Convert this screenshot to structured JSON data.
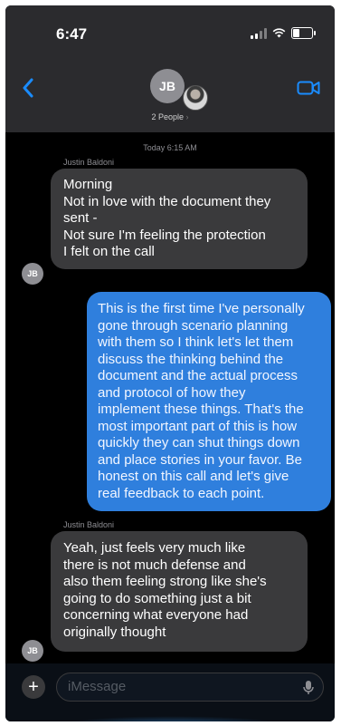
{
  "status_bar": {
    "time": "6:47"
  },
  "header": {
    "back_icon": "chevron-left-icon",
    "avatar_initials": "JB",
    "subtitle": "2 People",
    "video_icon": "video-camera-icon",
    "accent": "#1a8cff"
  },
  "conversation": {
    "timestamp": "Today 6:15 AM",
    "messages": [
      {
        "sender": "Justin Baldoni",
        "avatar": "JB",
        "direction": "received",
        "lines": [
          "Morning",
          "Not in love with the document they",
          "sent -",
          "Not sure I'm feeling the protection",
          "I felt on the call"
        ]
      },
      {
        "direction": "sent",
        "lines": [
          "This is the first time I've personally",
          "gone through scenario planning",
          "with them so I think let's let them",
          "discuss the thinking behind the",
          "document and the actual process",
          "and protocol of how they",
          "implement these things. That's the",
          "most important part of this is how",
          "quickly they can shut things down",
          "and place stories in your favor.  Be",
          "honest on this call and let's give",
          "real feedback to each point."
        ]
      },
      {
        "sender": "Justin Baldoni",
        "avatar": "JB",
        "direction": "received",
        "lines": [
          "Yeah, just feels very much like",
          "there is not much defense and",
          "also them feeling strong like she's",
          "going to do something just a bit",
          "concerning what everyone had",
          "originally thought"
        ]
      }
    ]
  },
  "composer": {
    "placeholder": "iMessage",
    "plus_icon": "plus-icon",
    "mic_icon": "microphone-icon"
  },
  "colors": {
    "sent_bubble": "#2f7fdd",
    "received_bubble": "#3a3a3c",
    "background": "#000000"
  }
}
